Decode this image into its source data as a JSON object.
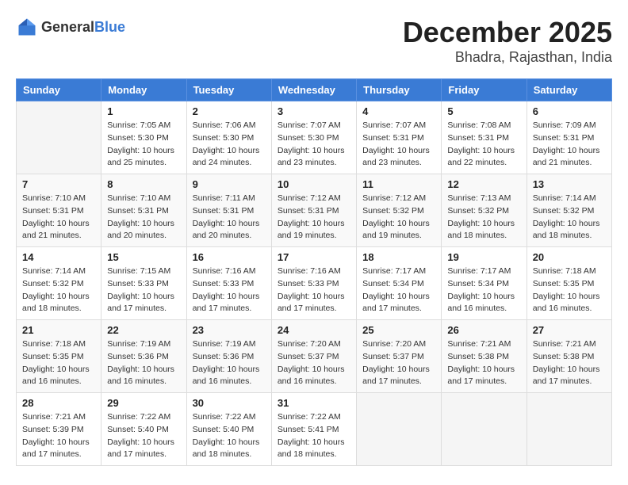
{
  "logo": {
    "general": "General",
    "blue": "Blue"
  },
  "title": {
    "month_year": "December 2025",
    "location": "Bhadra, Rajasthan, India"
  },
  "weekdays": [
    "Sunday",
    "Monday",
    "Tuesday",
    "Wednesday",
    "Thursday",
    "Friday",
    "Saturday"
  ],
  "weeks": [
    [
      {
        "day": "",
        "info": ""
      },
      {
        "day": "1",
        "info": "Sunrise: 7:05 AM\nSunset: 5:30 PM\nDaylight: 10 hours\nand 25 minutes."
      },
      {
        "day": "2",
        "info": "Sunrise: 7:06 AM\nSunset: 5:30 PM\nDaylight: 10 hours\nand 24 minutes."
      },
      {
        "day": "3",
        "info": "Sunrise: 7:07 AM\nSunset: 5:30 PM\nDaylight: 10 hours\nand 23 minutes."
      },
      {
        "day": "4",
        "info": "Sunrise: 7:07 AM\nSunset: 5:31 PM\nDaylight: 10 hours\nand 23 minutes."
      },
      {
        "day": "5",
        "info": "Sunrise: 7:08 AM\nSunset: 5:31 PM\nDaylight: 10 hours\nand 22 minutes."
      },
      {
        "day": "6",
        "info": "Sunrise: 7:09 AM\nSunset: 5:31 PM\nDaylight: 10 hours\nand 21 minutes."
      }
    ],
    [
      {
        "day": "7",
        "info": "Sunrise: 7:10 AM\nSunset: 5:31 PM\nDaylight: 10 hours\nand 21 minutes."
      },
      {
        "day": "8",
        "info": "Sunrise: 7:10 AM\nSunset: 5:31 PM\nDaylight: 10 hours\nand 20 minutes."
      },
      {
        "day": "9",
        "info": "Sunrise: 7:11 AM\nSunset: 5:31 PM\nDaylight: 10 hours\nand 20 minutes."
      },
      {
        "day": "10",
        "info": "Sunrise: 7:12 AM\nSunset: 5:31 PM\nDaylight: 10 hours\nand 19 minutes."
      },
      {
        "day": "11",
        "info": "Sunrise: 7:12 AM\nSunset: 5:32 PM\nDaylight: 10 hours\nand 19 minutes."
      },
      {
        "day": "12",
        "info": "Sunrise: 7:13 AM\nSunset: 5:32 PM\nDaylight: 10 hours\nand 18 minutes."
      },
      {
        "day": "13",
        "info": "Sunrise: 7:14 AM\nSunset: 5:32 PM\nDaylight: 10 hours\nand 18 minutes."
      }
    ],
    [
      {
        "day": "14",
        "info": "Sunrise: 7:14 AM\nSunset: 5:32 PM\nDaylight: 10 hours\nand 18 minutes."
      },
      {
        "day": "15",
        "info": "Sunrise: 7:15 AM\nSunset: 5:33 PM\nDaylight: 10 hours\nand 17 minutes."
      },
      {
        "day": "16",
        "info": "Sunrise: 7:16 AM\nSunset: 5:33 PM\nDaylight: 10 hours\nand 17 minutes."
      },
      {
        "day": "17",
        "info": "Sunrise: 7:16 AM\nSunset: 5:33 PM\nDaylight: 10 hours\nand 17 minutes."
      },
      {
        "day": "18",
        "info": "Sunrise: 7:17 AM\nSunset: 5:34 PM\nDaylight: 10 hours\nand 17 minutes."
      },
      {
        "day": "19",
        "info": "Sunrise: 7:17 AM\nSunset: 5:34 PM\nDaylight: 10 hours\nand 16 minutes."
      },
      {
        "day": "20",
        "info": "Sunrise: 7:18 AM\nSunset: 5:35 PM\nDaylight: 10 hours\nand 16 minutes."
      }
    ],
    [
      {
        "day": "21",
        "info": "Sunrise: 7:18 AM\nSunset: 5:35 PM\nDaylight: 10 hours\nand 16 minutes."
      },
      {
        "day": "22",
        "info": "Sunrise: 7:19 AM\nSunset: 5:36 PM\nDaylight: 10 hours\nand 16 minutes."
      },
      {
        "day": "23",
        "info": "Sunrise: 7:19 AM\nSunset: 5:36 PM\nDaylight: 10 hours\nand 16 minutes."
      },
      {
        "day": "24",
        "info": "Sunrise: 7:20 AM\nSunset: 5:37 PM\nDaylight: 10 hours\nand 16 minutes."
      },
      {
        "day": "25",
        "info": "Sunrise: 7:20 AM\nSunset: 5:37 PM\nDaylight: 10 hours\nand 17 minutes."
      },
      {
        "day": "26",
        "info": "Sunrise: 7:21 AM\nSunset: 5:38 PM\nDaylight: 10 hours\nand 17 minutes."
      },
      {
        "day": "27",
        "info": "Sunrise: 7:21 AM\nSunset: 5:38 PM\nDaylight: 10 hours\nand 17 minutes."
      }
    ],
    [
      {
        "day": "28",
        "info": "Sunrise: 7:21 AM\nSunset: 5:39 PM\nDaylight: 10 hours\nand 17 minutes."
      },
      {
        "day": "29",
        "info": "Sunrise: 7:22 AM\nSunset: 5:40 PM\nDaylight: 10 hours\nand 17 minutes."
      },
      {
        "day": "30",
        "info": "Sunrise: 7:22 AM\nSunset: 5:40 PM\nDaylight: 10 hours\nand 18 minutes."
      },
      {
        "day": "31",
        "info": "Sunrise: 7:22 AM\nSunset: 5:41 PM\nDaylight: 10 hours\nand 18 minutes."
      },
      {
        "day": "",
        "info": ""
      },
      {
        "day": "",
        "info": ""
      },
      {
        "day": "",
        "info": ""
      }
    ]
  ]
}
